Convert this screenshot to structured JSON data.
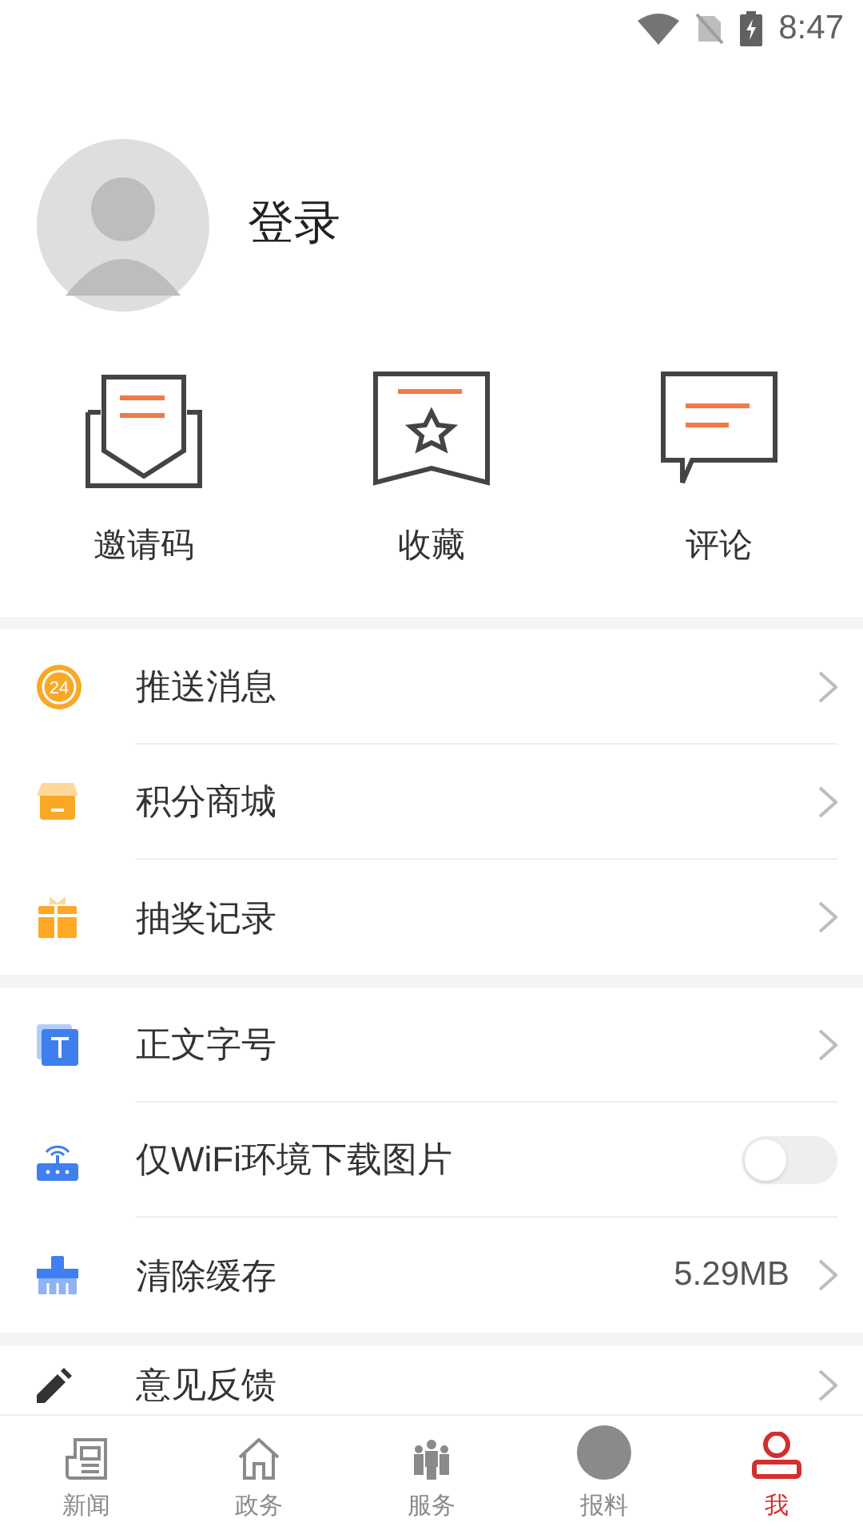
{
  "status_bar": {
    "time": "8:47"
  },
  "profile": {
    "login_label": "登录"
  },
  "shortcuts": [
    {
      "label": "邀请码"
    },
    {
      "label": "收藏"
    },
    {
      "label": "评论"
    }
  ],
  "sections": [
    [
      {
        "kind": "link",
        "label": "推送消息",
        "icon_text": "24"
      },
      {
        "kind": "link",
        "label": "积分商城"
      },
      {
        "kind": "link",
        "label": "抽奖记录"
      }
    ],
    [
      {
        "kind": "link",
        "label": "正文字号"
      },
      {
        "kind": "toggle",
        "label": "仅WiFi环境下载图片",
        "on": false
      },
      {
        "kind": "value",
        "label": "清除缓存",
        "value": "5.29MB"
      }
    ],
    [
      {
        "kind": "link",
        "label": "意见反馈"
      }
    ]
  ],
  "tab_bar": [
    {
      "label": "新闻",
      "selected": false
    },
    {
      "label": "政务",
      "selected": false
    },
    {
      "label": "服务",
      "selected": false
    },
    {
      "label": "报料",
      "selected": false
    },
    {
      "label": "我",
      "selected": true
    }
  ]
}
